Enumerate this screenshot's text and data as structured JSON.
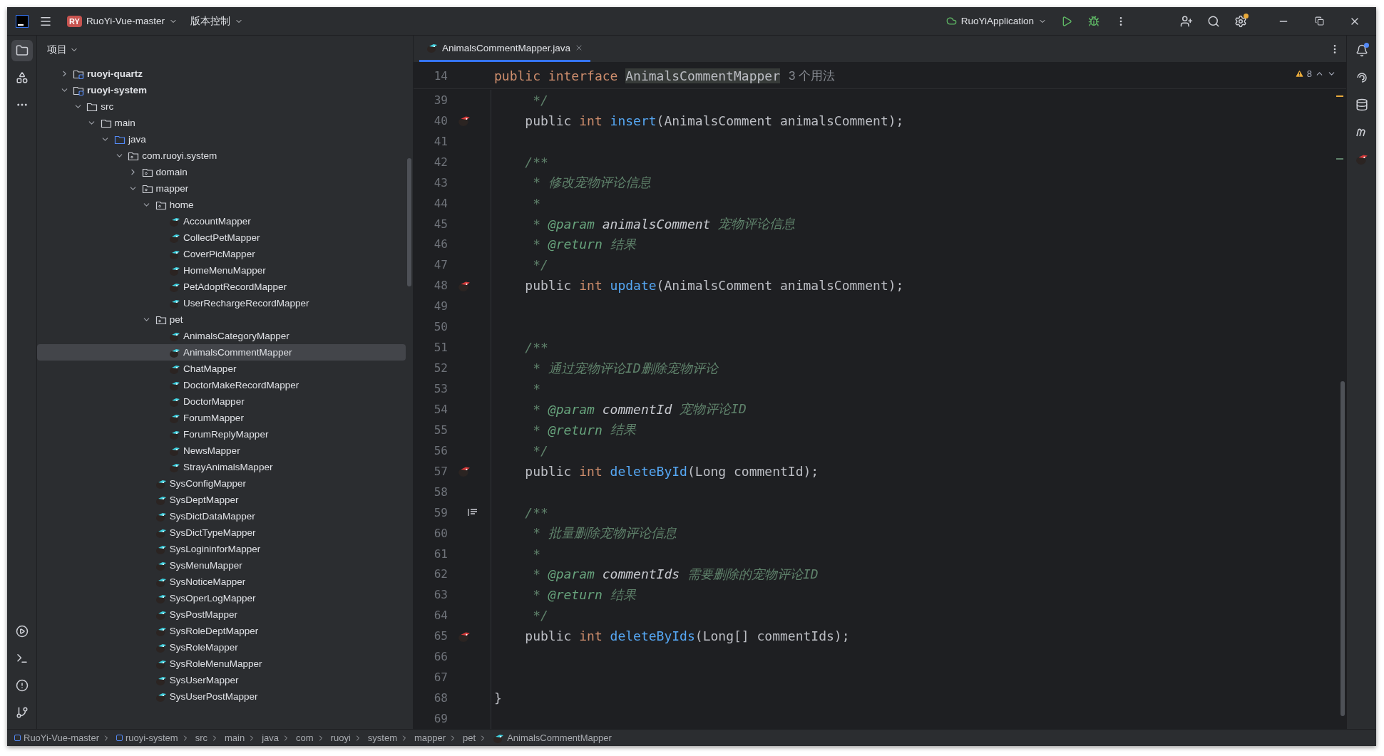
{
  "title_bar": {
    "project_badge": "RY",
    "project": "RuoYi-Vue-master",
    "vcs": "版本控制",
    "run_config": "RuoYiApplication"
  },
  "project_panel": {
    "title": "项目",
    "tree": [
      {
        "label": "ruoyi-quartz",
        "kind": "module",
        "selected": false,
        "expanded": false
      },
      {
        "label": "ruoyi-system",
        "kind": "module",
        "selected": false,
        "expanded": true,
        "children": [
          {
            "label": "src",
            "kind": "folder",
            "selected": false,
            "expanded": true,
            "children": [
              {
                "label": "main",
                "kind": "folder",
                "selected": false,
                "expanded": true,
                "children": [
                  {
                    "label": "java",
                    "kind": "source",
                    "selected": false,
                    "expanded": true,
                    "children": [
                      {
                        "label": "com.ruoyi.system",
                        "kind": "package",
                        "selected": false,
                        "expanded": true,
                        "children": [
                          {
                            "label": "domain",
                            "kind": "package",
                            "selected": false,
                            "expanded": false
                          },
                          {
                            "label": "mapper",
                            "kind": "package",
                            "selected": false,
                            "expanded": true,
                            "children": [
                              {
                                "label": "home",
                                "kind": "package",
                                "selected": false,
                                "expanded": true,
                                "children": [
                                  {
                                    "label": "AccountMapper",
                                    "kind": "mapper",
                                    "selected": false
                                  },
                                  {
                                    "label": "CollectPetMapper",
                                    "kind": "mapper",
                                    "selected": false
                                  },
                                  {
                                    "label": "CoverPicMapper",
                                    "kind": "mapper",
                                    "selected": false
                                  },
                                  {
                                    "label": "HomeMenuMapper",
                                    "kind": "mapper",
                                    "selected": false
                                  },
                                  {
                                    "label": "PetAdoptRecordMapper",
                                    "kind": "mapper",
                                    "selected": false
                                  },
                                  {
                                    "label": "UserRechargeRecordMapper",
                                    "kind": "mapper",
                                    "selected": false
                                  }
                                ]
                              },
                              {
                                "label": "pet",
                                "kind": "package",
                                "selected": false,
                                "expanded": true,
                                "children": [
                                  {
                                    "label": "AnimalsCategoryMapper",
                                    "kind": "mapper",
                                    "selected": false
                                  },
                                  {
                                    "label": "AnimalsCommentMapper",
                                    "kind": "mapper",
                                    "selected": true
                                  },
                                  {
                                    "label": "ChatMapper",
                                    "kind": "mapper",
                                    "selected": false
                                  },
                                  {
                                    "label": "DoctorMakeRecordMapper",
                                    "kind": "mapper",
                                    "selected": false
                                  },
                                  {
                                    "label": "DoctorMapper",
                                    "kind": "mapper",
                                    "selected": false
                                  },
                                  {
                                    "label": "ForumMapper",
                                    "kind": "mapper",
                                    "selected": false
                                  },
                                  {
                                    "label": "ForumReplyMapper",
                                    "kind": "mapper",
                                    "selected": false
                                  },
                                  {
                                    "label": "NewsMapper",
                                    "kind": "mapper",
                                    "selected": false
                                  },
                                  {
                                    "label": "StrayAnimalsMapper",
                                    "kind": "mapper",
                                    "selected": false
                                  }
                                ]
                              },
                              {
                                "label": "SysConfigMapper",
                                "kind": "mapper",
                                "selected": false
                              },
                              {
                                "label": "SysDeptMapper",
                                "kind": "mapper",
                                "selected": false
                              },
                              {
                                "label": "SysDictDataMapper",
                                "kind": "mapper",
                                "selected": false
                              },
                              {
                                "label": "SysDictTypeMapper",
                                "kind": "mapper",
                                "selected": false
                              },
                              {
                                "label": "SysLogininforMapper",
                                "kind": "mapper",
                                "selected": false
                              },
                              {
                                "label": "SysMenuMapper",
                                "kind": "mapper",
                                "selected": false
                              },
                              {
                                "label": "SysNoticeMapper",
                                "kind": "mapper",
                                "selected": false
                              },
                              {
                                "label": "SysOperLogMapper",
                                "kind": "mapper",
                                "selected": false
                              },
                              {
                                "label": "SysPostMapper",
                                "kind": "mapper",
                                "selected": false
                              },
                              {
                                "label": "SysRoleDeptMapper",
                                "kind": "mapper",
                                "selected": false
                              },
                              {
                                "label": "SysRoleMapper",
                                "kind": "mapper",
                                "selected": false
                              },
                              {
                                "label": "SysRoleMenuMapper",
                                "kind": "mapper",
                                "selected": false
                              },
                              {
                                "label": "SysUserMapper",
                                "kind": "mapper",
                                "selected": false
                              },
                              {
                                "label": "SysUserPostMapper",
                                "kind": "mapper",
                                "selected": false
                              }
                            ]
                          }
                        ]
                      }
                    ]
                  }
                ]
              }
            ]
          }
        ]
      }
    ]
  },
  "editor": {
    "tabs": [
      {
        "label": "AnimalsCommentMapper.java",
        "selected": true
      }
    ],
    "sticky": {
      "number": "14",
      "tokens": [
        {
          "kind": "keyword",
          "text": "public interface "
        },
        {
          "kind": "highlight",
          "text": "AnimalsCommentMapper"
        }
      ],
      "hint": "3 个用法"
    },
    "warning_count": "8",
    "lines": [
      {
        "number": "39",
        "kind": "plain",
        "tokens": [
          {
            "kind": "comment",
            "text": "     */"
          }
        ]
      },
      {
        "number": "40",
        "kind": "mapped",
        "tokens": [
          {
            "kind": "plain",
            "text": "    public "
          },
          {
            "kind": "keyword",
            "text": "int "
          },
          {
            "kind": "method",
            "text": "insert"
          },
          {
            "kind": "plain",
            "text": "(AnimalsComment animalsComment);"
          }
        ]
      },
      {
        "number": "41",
        "kind": "plain"
      },
      {
        "number": "42",
        "kind": "plain",
        "tokens": [
          {
            "kind": "comment",
            "text": "    /**"
          }
        ]
      },
      {
        "number": "43",
        "kind": "plain",
        "tokens": [
          {
            "kind": "comment",
            "text": "     * 修改宠物评论信息"
          }
        ]
      },
      {
        "number": "44",
        "kind": "plain",
        "tokens": [
          {
            "kind": "comment",
            "text": "     *"
          }
        ]
      },
      {
        "number": "45",
        "kind": "plain",
        "tokens": [
          {
            "kind": "comment",
            "text": "     * "
          },
          {
            "kind": "tag",
            "text": "@param"
          },
          {
            "kind": "param",
            "text": " animalsComment"
          },
          {
            "kind": "comment",
            "text": " 宠物评论信息"
          }
        ]
      },
      {
        "number": "46",
        "kind": "plain",
        "tokens": [
          {
            "kind": "comment",
            "text": "     * "
          },
          {
            "kind": "tag",
            "text": "@return"
          },
          {
            "kind": "comment",
            "text": " 结果"
          }
        ]
      },
      {
        "number": "47",
        "kind": "plain",
        "tokens": [
          {
            "kind": "comment",
            "text": "     */"
          }
        ]
      },
      {
        "number": "48",
        "kind": "mapped",
        "tokens": [
          {
            "kind": "plain",
            "text": "    public "
          },
          {
            "kind": "keyword",
            "text": "int "
          },
          {
            "kind": "method",
            "text": "update"
          },
          {
            "kind": "plain",
            "text": "(AnimalsComment animalsComment);"
          }
        ]
      },
      {
        "number": "49",
        "kind": "plain"
      },
      {
        "number": "50",
        "kind": "plain"
      },
      {
        "number": "51",
        "kind": "plain",
        "tokens": [
          {
            "kind": "comment",
            "text": "    /**"
          }
        ]
      },
      {
        "number": "52",
        "kind": "plain",
        "tokens": [
          {
            "kind": "comment",
            "text": "     * 通过宠物评论ID删除宠物评论"
          }
        ]
      },
      {
        "number": "53",
        "kind": "plain",
        "tokens": [
          {
            "kind": "comment",
            "text": "     *"
          }
        ]
      },
      {
        "number": "54",
        "kind": "plain",
        "tokens": [
          {
            "kind": "comment",
            "text": "     * "
          },
          {
            "kind": "tag",
            "text": "@param"
          },
          {
            "kind": "param",
            "text": " commentId"
          },
          {
            "kind": "comment",
            "text": " 宠物评论ID"
          }
        ]
      },
      {
        "number": "55",
        "kind": "plain",
        "tokens": [
          {
            "kind": "comment",
            "text": "     * "
          },
          {
            "kind": "tag",
            "text": "@return"
          },
          {
            "kind": "comment",
            "text": " 结果"
          }
        ]
      },
      {
        "number": "56",
        "kind": "plain",
        "tokens": [
          {
            "kind": "comment",
            "text": "     */"
          }
        ]
      },
      {
        "number": "57",
        "kind": "mapped",
        "tokens": [
          {
            "kind": "plain",
            "text": "    public "
          },
          {
            "kind": "keyword",
            "text": "int "
          },
          {
            "kind": "method",
            "text": "deleteById"
          },
          {
            "kind": "plain",
            "text": "(Long commentId);"
          }
        ]
      },
      {
        "number": "58",
        "kind": "plain"
      },
      {
        "number": "59",
        "kind": "doc",
        "tokens": [
          {
            "kind": "comment",
            "text": "    /**"
          }
        ]
      },
      {
        "number": "60",
        "kind": "plain",
        "tokens": [
          {
            "kind": "comment",
            "text": "     * 批量删除宠物评论信息"
          }
        ]
      },
      {
        "number": "61",
        "kind": "plain",
        "tokens": [
          {
            "kind": "comment",
            "text": "     *"
          }
        ]
      },
      {
        "number": "62",
        "kind": "plain",
        "tokens": [
          {
            "kind": "comment",
            "text": "     * "
          },
          {
            "kind": "tag",
            "text": "@param"
          },
          {
            "kind": "param",
            "text": " commentIds"
          },
          {
            "kind": "comment",
            "text": " 需要删除的宠物评论ID"
          }
        ]
      },
      {
        "number": "63",
        "kind": "plain",
        "tokens": [
          {
            "kind": "comment",
            "text": "     * "
          },
          {
            "kind": "tag",
            "text": "@return"
          },
          {
            "kind": "comment",
            "text": " 结果"
          }
        ]
      },
      {
        "number": "64",
        "kind": "plain",
        "tokens": [
          {
            "kind": "comment",
            "text": "     */"
          }
        ]
      },
      {
        "number": "65",
        "kind": "mapped",
        "tokens": [
          {
            "kind": "plain",
            "text": "    public "
          },
          {
            "kind": "keyword",
            "text": "int "
          },
          {
            "kind": "method",
            "text": "deleteByIds"
          },
          {
            "kind": "plain",
            "text": "(Long[] commentIds);"
          }
        ]
      },
      {
        "number": "66",
        "kind": "plain"
      },
      {
        "number": "67",
        "kind": "plain"
      },
      {
        "number": "68",
        "kind": "plain",
        "tokens": [
          {
            "kind": "plain",
            "text": "}"
          }
        ]
      },
      {
        "number": "69",
        "kind": "plain"
      }
    ]
  },
  "breadcrumbs": [
    {
      "label": "RuoYi-Vue-master",
      "kind": "module"
    },
    {
      "label": "ruoyi-system",
      "kind": "module"
    },
    {
      "label": "src",
      "kind": "plain"
    },
    {
      "label": "main",
      "kind": "plain"
    },
    {
      "label": "java",
      "kind": "plain"
    },
    {
      "label": "com",
      "kind": "plain"
    },
    {
      "label": "ruoyi",
      "kind": "plain"
    },
    {
      "label": "system",
      "kind": "plain"
    },
    {
      "label": "mapper",
      "kind": "plain"
    },
    {
      "label": "pet",
      "kind": "plain"
    },
    {
      "label": "AnimalsCommentMapper",
      "kind": "mapper"
    }
  ]
}
